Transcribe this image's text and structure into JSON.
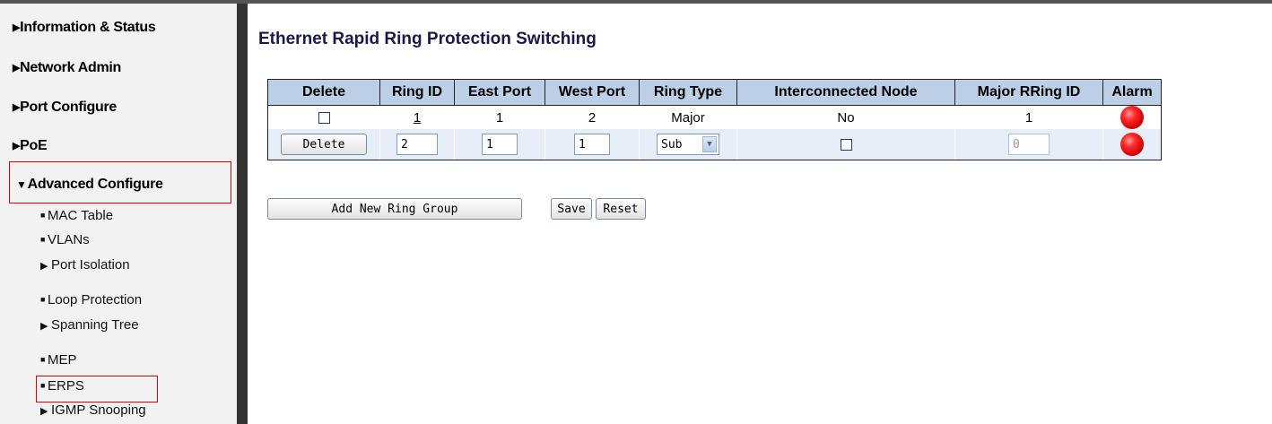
{
  "sidebar": {
    "top_items": [
      {
        "label": "Information & Status"
      },
      {
        "label": "Network Admin"
      },
      {
        "label": "Port Configure"
      },
      {
        "label": "PoE"
      },
      {
        "label": "Advanced Configure"
      }
    ],
    "sub_items": [
      {
        "label": "MAC Table"
      },
      {
        "label": "VLANs"
      },
      {
        "label": "Port Isolation"
      },
      {
        "label": "Loop Protection"
      },
      {
        "label": "Spanning Tree"
      },
      {
        "label": "MEP"
      },
      {
        "label": "ERPS"
      },
      {
        "label": "IGMP Snooping"
      }
    ]
  },
  "page": {
    "title": "Ethernet Rapid Ring Protection Switching"
  },
  "table": {
    "headers": [
      "Delete",
      "Ring ID",
      "East Port",
      "West Port",
      "Ring Type",
      "Interconnected Node",
      "Major RRing ID",
      "Alarm"
    ],
    "row1": {
      "ring_id": "1",
      "east_port": "1",
      "west_port": "2",
      "ring_type": "Major",
      "interconnected_node": "No",
      "major_rring_id": "1"
    },
    "row2": {
      "delete_label": "Delete",
      "ring_id": "2",
      "east_port": "1",
      "west_port": "1",
      "ring_type": "Sub",
      "major_rring_id": "0"
    }
  },
  "actions": {
    "add_label": "Add New Ring Group",
    "save_label": "Save",
    "reset_label": "Reset"
  },
  "colors": {
    "header_bg": "#bccfe6",
    "highlight": "#e00000",
    "alarm": "#e00000"
  }
}
